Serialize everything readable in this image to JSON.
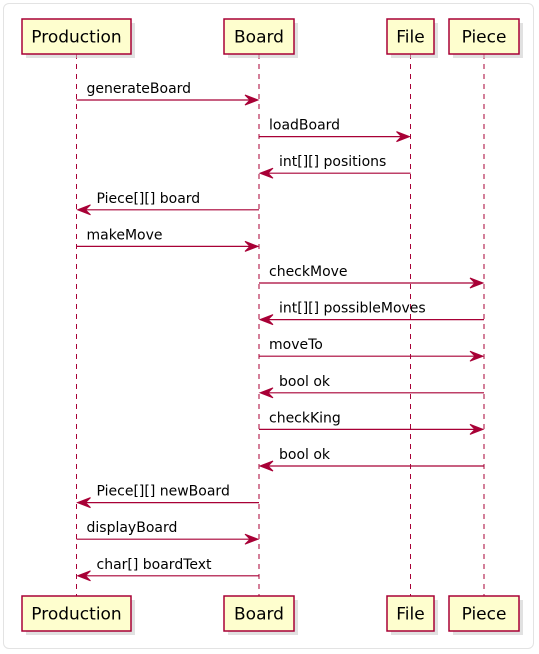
{
  "participants": [
    {
      "id": "production",
      "label": "Production"
    },
    {
      "id": "board",
      "label": "Board"
    },
    {
      "id": "file",
      "label": "File"
    },
    {
      "id": "piece",
      "label": "Piece"
    }
  ],
  "messages": [
    {
      "from": "production",
      "to": "board",
      "label": "generateBoard"
    },
    {
      "from": "board",
      "to": "file",
      "label": "loadBoard"
    },
    {
      "from": "file",
      "to": "board",
      "label": "int[][] positions"
    },
    {
      "from": "board",
      "to": "production",
      "label": "Piece[][] board"
    },
    {
      "from": "production",
      "to": "board",
      "label": "makeMove"
    },
    {
      "from": "board",
      "to": "piece",
      "label": "checkMove"
    },
    {
      "from": "piece",
      "to": "board",
      "label": "int[][] possibleMoves"
    },
    {
      "from": "board",
      "to": "piece",
      "label": "moveTo"
    },
    {
      "from": "piece",
      "to": "board",
      "label": "bool ok"
    },
    {
      "from": "board",
      "to": "piece",
      "label": "checkKing"
    },
    {
      "from": "piece",
      "to": "board",
      "label": "bool ok"
    },
    {
      "from": "board",
      "to": "production",
      "label": "Piece[][] newBoard"
    },
    {
      "from": "production",
      "to": "board",
      "label": "displayBoard"
    },
    {
      "from": "board",
      "to": "production",
      "label": "char[] boardText"
    }
  ],
  "colors": {
    "participant_fill": "#fefece",
    "participant_border": "#a80036",
    "lifeline": "#a80036",
    "arrow": "#a80036",
    "text": "#000000"
  }
}
